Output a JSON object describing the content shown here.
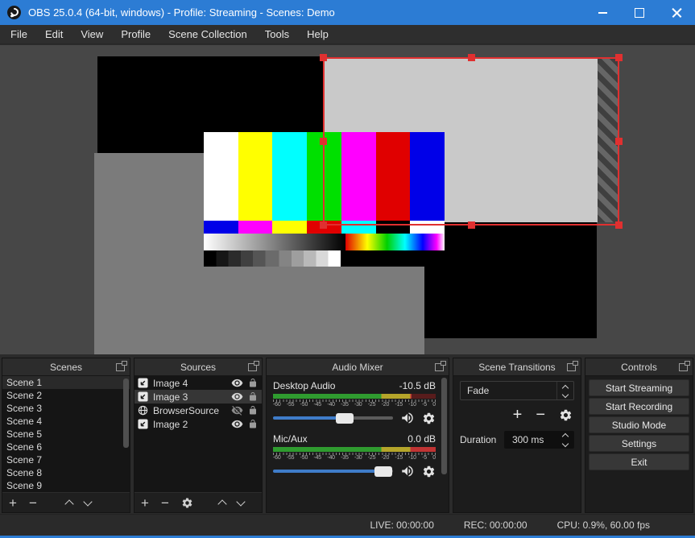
{
  "window": {
    "title": "OBS 25.0.4 (64-bit, windows) - Profile: Streaming - Scenes: Demo"
  },
  "menu": {
    "items": [
      "File",
      "Edit",
      "View",
      "Profile",
      "Scene Collection",
      "Tools",
      "Help"
    ]
  },
  "icons": {
    "plus": "+",
    "minus": "−"
  },
  "colors": {
    "accent_blue": "#2c7cd4",
    "selection_red": "#e03030",
    "slider_blue": "#3f7cc9",
    "meter_green": "#2f9b2f",
    "meter_yellow": "#b5a52a",
    "meter_red": "#c03434"
  },
  "panels": {
    "scenes": {
      "title": "Scenes",
      "items": [
        "Scene 1",
        "Scene 2",
        "Scene 3",
        "Scene 4",
        "Scene 5",
        "Scene 6",
        "Scene 7",
        "Scene 8",
        "Scene 9"
      ],
      "selected": "Scene 1"
    },
    "sources": {
      "title": "Sources",
      "items": [
        {
          "name": "Image 4",
          "type": "image",
          "visible": true,
          "locked": false,
          "selected": false
        },
        {
          "name": "Image 3",
          "type": "image",
          "visible": true,
          "locked": false,
          "selected": true
        },
        {
          "name": "BrowserSource",
          "type": "browser",
          "visible": false,
          "locked": false,
          "selected": false
        },
        {
          "name": "Image 2",
          "type": "image",
          "visible": true,
          "locked": false,
          "selected": false
        }
      ]
    },
    "audio_mixer": {
      "title": "Audio Mixer",
      "ticks": [
        "-60",
        "-55",
        "-50",
        "-45",
        "-40",
        "-35",
        "-30",
        "-25",
        "-20",
        "-15",
        "-10",
        "-5",
        "0"
      ],
      "channels": [
        {
          "name": "Desktop Audio",
          "level_db": "-10.5 dB",
          "slider_pct": 60,
          "meter_pct": 85
        },
        {
          "name": "Mic/Aux",
          "level_db": "0.0 dB",
          "slider_pct": 92,
          "meter_pct": 100
        }
      ]
    },
    "transitions": {
      "title": "Scene Transitions",
      "current": "Fade",
      "duration_label": "Duration",
      "duration_value": "300 ms"
    },
    "controls": {
      "title": "Controls",
      "buttons": [
        "Start Streaming",
        "Start Recording",
        "Studio Mode",
        "Settings",
        "Exit"
      ]
    }
  },
  "statusbar": {
    "live": "LIVE: 00:00:00",
    "rec": "REC: 00:00:00",
    "cpu": "CPU: 0.9%, 60.00 fps"
  }
}
